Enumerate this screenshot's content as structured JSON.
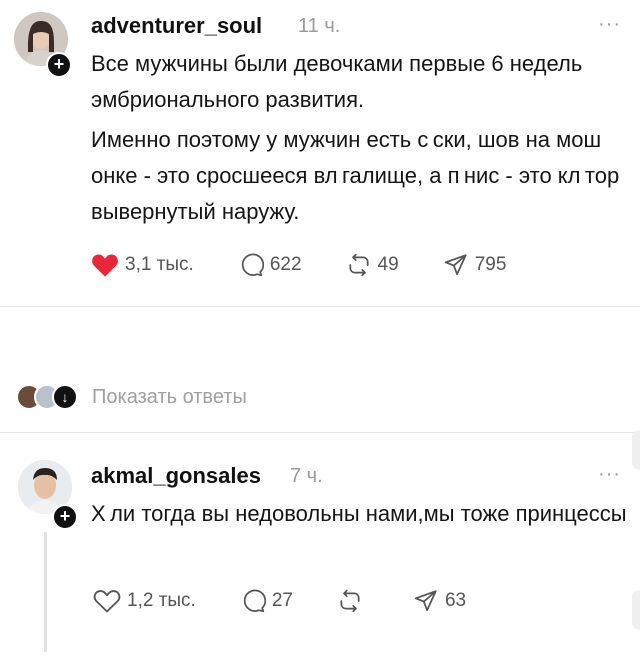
{
  "post1": {
    "username": "adventurer_soul",
    "time": "11 ч.",
    "more": "···",
    "text_p1": "Все мужчины были девочками первые 6 недель эмбрионального развития.",
    "text_p2": "Именно поэтому у мужчин есть с ски, шов на мош онке - это сросшееся вл галище, а п нис - это кл тор вывернутый наружу.",
    "likes": "3,1 тыс.",
    "comments": "622",
    "reposts": "49",
    "shares": "795"
  },
  "replies_link": "Показать ответы",
  "post2": {
    "username": "akmal_gonsales",
    "time": "7 ч.",
    "more": "···",
    "text": "Х ли тогда вы недовольны нами,мы тоже принцессы",
    "likes": "1,2 тыс.",
    "comments": "27",
    "reposts": "",
    "shares": "63"
  },
  "colors": {
    "like_red": "#ff3040",
    "muted": "#9a9a9a"
  }
}
